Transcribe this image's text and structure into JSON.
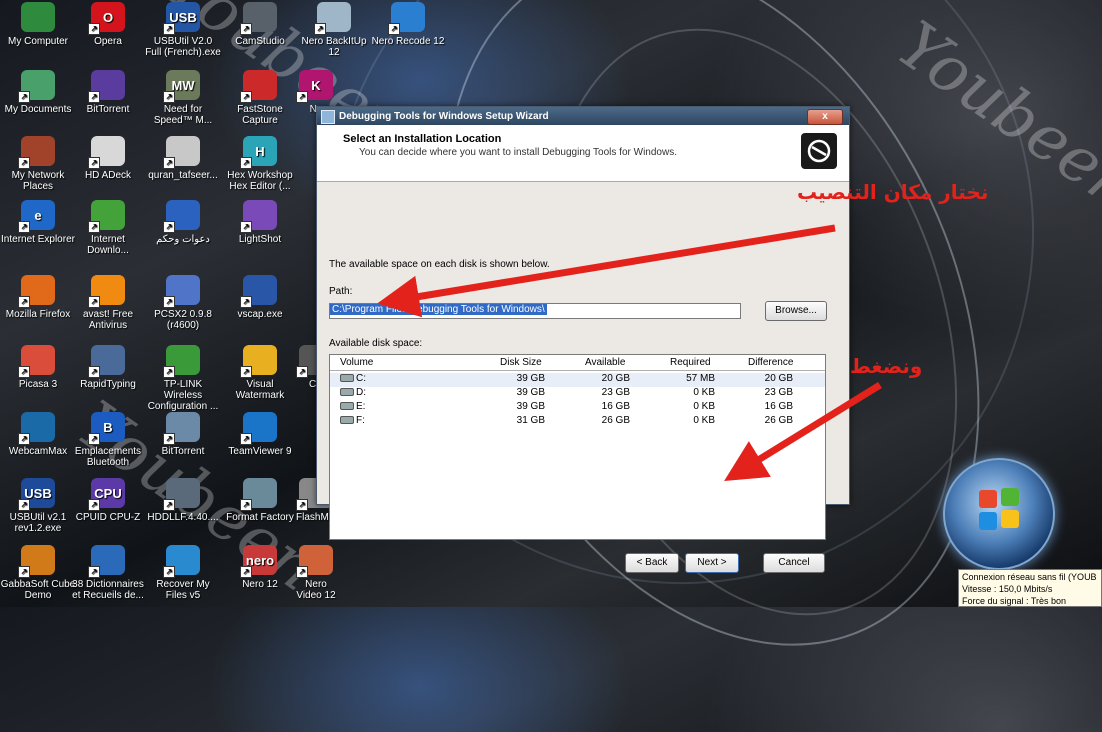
{
  "desktop_icons": [
    {
      "label": "My Computer",
      "color": "#2e8b3e",
      "glyph": ""
    },
    {
      "label": "Opera",
      "color": "#d3141d",
      "glyph": "O"
    },
    {
      "label": "USBUtil V2.0 Full (French).exe",
      "color": "#2456a6",
      "glyph": "USB"
    },
    {
      "label": "CamStudio",
      "color": "#58606a",
      "glyph": ""
    },
    {
      "label": "Nero BackItUp 12",
      "color": "#9fb6c8",
      "glyph": ""
    },
    {
      "label": "Nero Recode 12",
      "color": "#2a7fd0",
      "glyph": ""
    },
    {
      "label": "My Documents",
      "color": "#4aa06a",
      "glyph": ""
    },
    {
      "label": "BitTorrent",
      "color": "#5a3b9e",
      "glyph": ""
    },
    {
      "label": "Need for Speed™ M...",
      "color": "#6a7a5a",
      "glyph": "MW"
    },
    {
      "label": "FastStone Capture",
      "color": "#cc2a2a",
      "glyph": ""
    },
    {
      "label": "Ne",
      "color": "#b01670",
      "glyph": "K"
    },
    {
      "label": "My Network Places",
      "color": "#a0432a",
      "glyph": ""
    },
    {
      "label": "HD ADeck",
      "color": "#d8d8d8",
      "glyph": ""
    },
    {
      "label": "quran_tafseer...",
      "color": "#c8c8c8",
      "glyph": ""
    },
    {
      "label": "Hex Workshop Hex Editor (...",
      "color": "#2ba4b8",
      "glyph": "H"
    },
    {
      "label": "Internet Explorer",
      "color": "#1f68c8",
      "glyph": "e"
    },
    {
      "label": "Internet Downlo...",
      "color": "#44a23a",
      "glyph": ""
    },
    {
      "label": "دعوات وحكم",
      "color": "#2b62c0",
      "glyph": ""
    },
    {
      "label": "LightShot",
      "color": "#7a4bb8",
      "glyph": ""
    },
    {
      "label": "Mozilla Firefox",
      "color": "#e06a1a",
      "glyph": ""
    },
    {
      "label": "avast! Free Antivirus",
      "color": "#f08a10",
      "glyph": ""
    },
    {
      "label": "PCSX2 0.9.8 (r4600)",
      "color": "#4f74c8",
      "glyph": ""
    },
    {
      "label": "vscap.exe",
      "color": "#2a56a8",
      "glyph": ""
    },
    {
      "label": "Picasa 3",
      "color": "#d94d3a",
      "glyph": ""
    },
    {
      "label": "RapidTyping",
      "color": "#4a6a9a",
      "glyph": ""
    },
    {
      "label": "TP-LINK Wireless Configuration ...",
      "color": "#3a9a3a",
      "glyph": ""
    },
    {
      "label": "Visual Watermark",
      "color": "#e8b020",
      "glyph": ""
    },
    {
      "label": "CP",
      "color": "#555",
      "glyph": ""
    },
    {
      "label": "WebcamMax",
      "color": "#1a6aa8",
      "glyph": ""
    },
    {
      "label": "Emplacements Bluetooth",
      "color": "#1c5bc0",
      "glyph": "B"
    },
    {
      "label": "BitTorrent",
      "color": "#6a8aa8",
      "glyph": ""
    },
    {
      "label": "TeamViewer 9",
      "color": "#1a74c8",
      "glyph": ""
    },
    {
      "label": "USBUtil v2.1 rev1.2.exe",
      "color": "#1e4a9a",
      "glyph": "USB"
    },
    {
      "label": "CPUID CPU-Z",
      "color": "#5b3aa8",
      "glyph": "CPU"
    },
    {
      "label": "HDDLLF.4.40....",
      "color": "#5a6a7a",
      "glyph": ""
    },
    {
      "label": "Format Factory",
      "color": "#6a8a9a",
      "glyph": ""
    },
    {
      "label": "FlashMemory...",
      "color": "#888",
      "glyph": ""
    },
    {
      "label": "GabbaSoft Cube Demo",
      "color": "#d07a1a",
      "glyph": ""
    },
    {
      "label": "38 Dictionnaires et Recueils de...",
      "color": "#2a6ab8",
      "glyph": ""
    },
    {
      "label": "Recover My Files v5",
      "color": "#2a8ad0",
      "glyph": ""
    },
    {
      "label": "Nero 12",
      "color": "#c83a3a",
      "glyph": "nero"
    },
    {
      "label": "Nero Video 12",
      "color": "#d0623a",
      "glyph": ""
    }
  ],
  "dialog": {
    "title": "Debugging Tools for Windows Setup Wizard",
    "close": "x",
    "heading": "Select an Installation Location",
    "subheading": "You can decide where you want to install Debugging Tools for Windows.",
    "info": "The available space on each disk is shown below.",
    "path_label": "Path:",
    "path_value": "C:\\Program Files\\Debugging Tools for Windows\\",
    "browse_label": "Browse...",
    "disk_label": "Available disk space:",
    "columns": [
      "Volume",
      "Disk Size",
      "Available",
      "Required",
      "Difference"
    ],
    "rows": [
      {
        "volume": "C:",
        "disk_size": "39 GB",
        "available": "20 GB",
        "required": "57 MB",
        "difference": "20 GB"
      },
      {
        "volume": "D:",
        "disk_size": "39 GB",
        "available": "23 GB",
        "required": "0 KB",
        "difference": "23 GB"
      },
      {
        "volume": "E:",
        "disk_size": "39 GB",
        "available": "16 GB",
        "required": "0 KB",
        "difference": "16 GB"
      },
      {
        "volume": "F:",
        "disk_size": "31 GB",
        "available": "26 GB",
        "required": "0 KB",
        "difference": "26 GB"
      }
    ],
    "back_label": "< Back",
    "next_label": "Next >",
    "cancel_label": "Cancel"
  },
  "annotations": {
    "choose_location": "نختار مكان التنصيب",
    "press": "ونضغط"
  },
  "watermark": "Youbeen",
  "tray": {
    "line1": "Connexion réseau sans fil (YOUB",
    "line2": "Vitesse : 150,0 Mbits/s",
    "line3": "Force du signal : Très bon"
  },
  "colors": {
    "annotation_red": "#e3231b",
    "title_blue": "#2e4660"
  }
}
